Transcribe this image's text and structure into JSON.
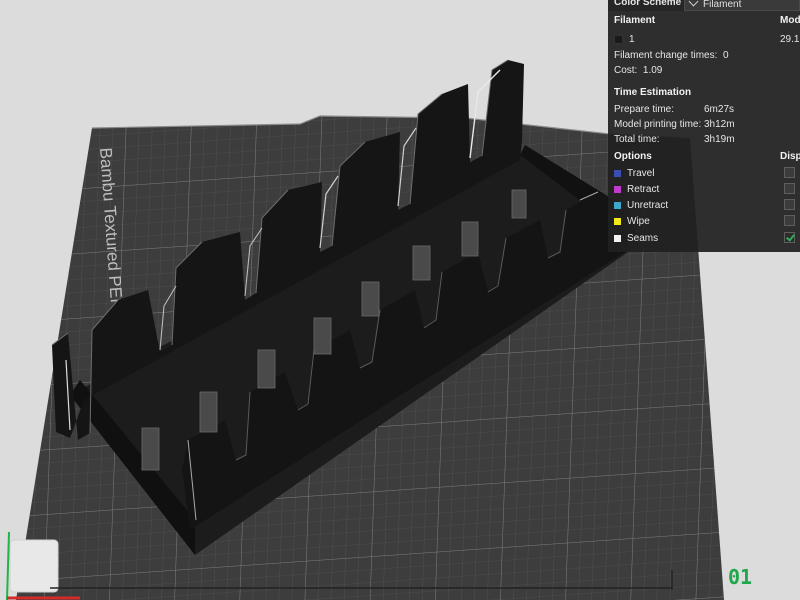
{
  "plate": {
    "label": "Bambu Textured PEI Plate"
  },
  "panel": {
    "color_scheme_label": "Color Scheme",
    "color_scheme_value": "Filament",
    "filament_header": "Filament",
    "model_header": "Mod",
    "filament_row": {
      "index": "1",
      "model_value": "29.1",
      "color": "#1a1a1a"
    },
    "filament_change_label": "Filament change times:",
    "filament_change_value": "0",
    "cost_label": "Cost:",
    "cost_value": "1.09",
    "time_estimation_header": "Time Estimation",
    "prepare_time_label": "Prepare time:",
    "prepare_time_value": "6m27s",
    "model_printing_label": "Model printing time:",
    "model_printing_value": "3h12m",
    "total_time_label": "Total time:",
    "total_time_value": "3h19m",
    "options_header": "Options",
    "display_header": "Disp",
    "options": [
      {
        "label": "Travel",
        "color": "#3a4fb4",
        "checked": false
      },
      {
        "label": "Retract",
        "color": "#c43ad0",
        "checked": false
      },
      {
        "label": "Unretract",
        "color": "#3aa8c8",
        "checked": false
      },
      {
        "label": "Wipe",
        "color": "#f2e81a",
        "checked": false
      },
      {
        "label": "Seams",
        "color": "#f2f2f2",
        "checked": true
      }
    ]
  },
  "layer_slider": {
    "value": "01"
  },
  "colors": {
    "background": "#dcdcdc",
    "plate": "#3d3d3d",
    "model": "#161616",
    "accent_green": "#1fa84b"
  }
}
